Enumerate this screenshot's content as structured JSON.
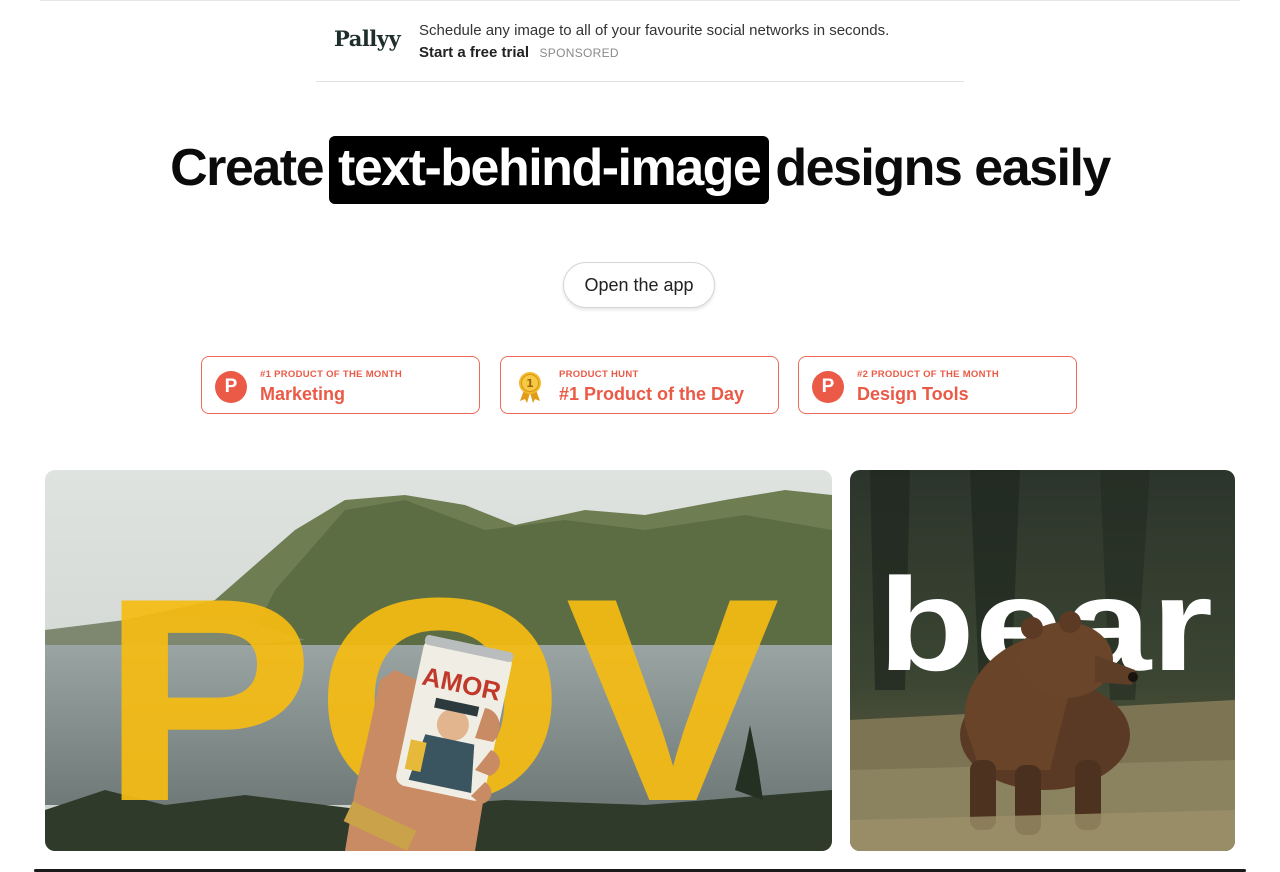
{
  "ad": {
    "logo": "Pallyy",
    "text": "Schedule any image to all of your favourite social networks in seconds.",
    "cta": "Start a free trial",
    "sponsored": "SPONSORED"
  },
  "hero": {
    "before": "Create",
    "highlight": "text-behind-image",
    "after": "designs easily"
  },
  "open_app_label": "Open the app",
  "badges": [
    {
      "icon": "producthunt-icon",
      "small": "#1 PRODUCT OF THE MONTH",
      "big": "Marketing"
    },
    {
      "icon": "medal-icon",
      "small": "PRODUCT HUNT",
      "big": "#1 Product of the Day",
      "medal_number": "1"
    },
    {
      "icon": "producthunt-icon",
      "small": "#2 PRODUCT OF THE MONTH",
      "big": "Design Tools"
    }
  ],
  "examples": [
    {
      "text": "POV",
      "can_text": "AMOR",
      "text_color": "#f5bb12"
    },
    {
      "text": "bear",
      "text_color": "#ffffff"
    }
  ],
  "colors": {
    "accent": "#ea5a47",
    "headline": "#000000"
  }
}
